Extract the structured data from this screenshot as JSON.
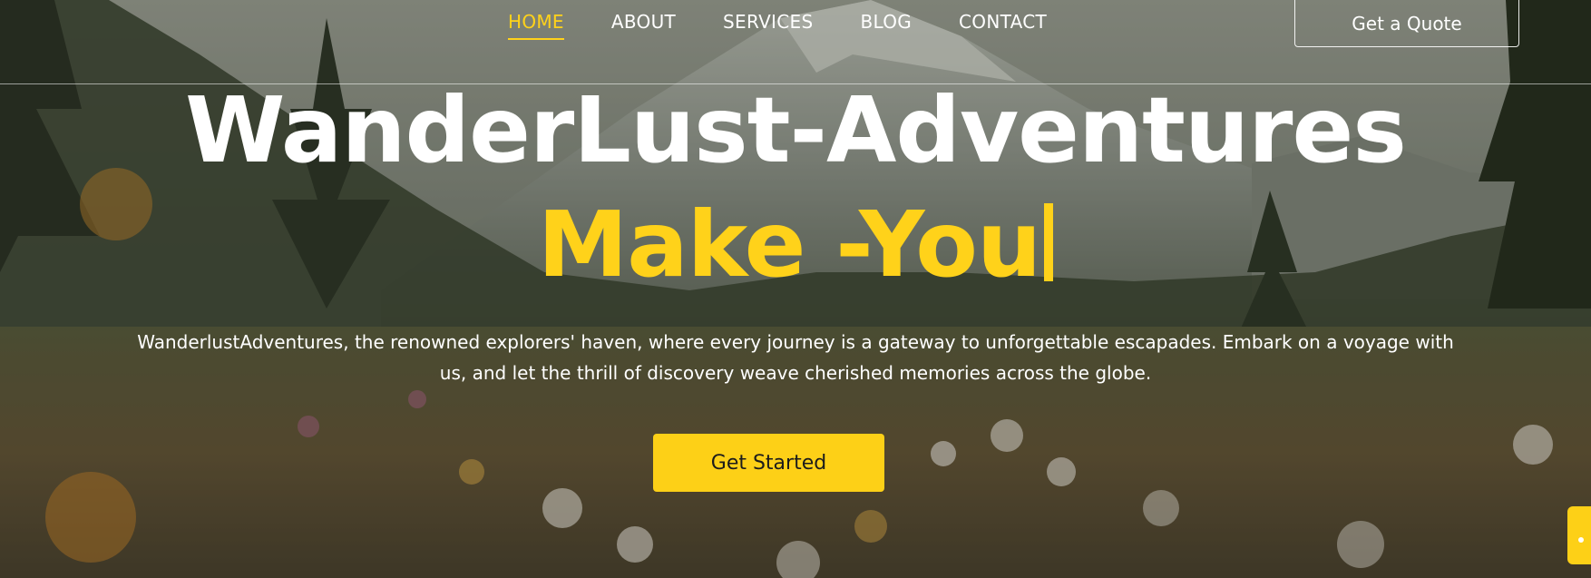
{
  "nav": {
    "items": [
      {
        "label": "HOME",
        "active": true
      },
      {
        "label": "ABOUT",
        "active": false
      },
      {
        "label": "SERVICES",
        "active": false
      },
      {
        "label": "BLOG",
        "active": false
      },
      {
        "label": "CONTACT",
        "active": false
      }
    ],
    "quote_button": "Get a Quote"
  },
  "hero": {
    "title": "WanderLust-Adventures",
    "subtitle": "Make -You",
    "description": "WanderlustAdventures, the renowned explorers' haven, where every journey is a gateway to unforgettable escapades. Embark on a voyage with us, and let the thrill of discovery weave cherished memories across the globe.",
    "cta_label": "Get Started"
  },
  "colors": {
    "accent": "#ffd21a",
    "button_bg": "#fdd017",
    "text": "#ffffff"
  },
  "icons": {
    "floating_button": "scroll-up-icon"
  }
}
